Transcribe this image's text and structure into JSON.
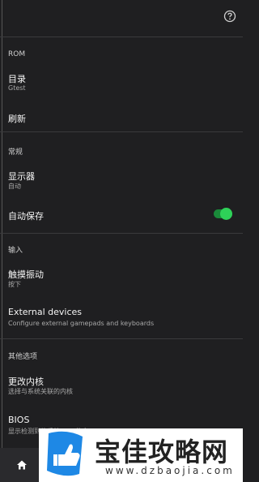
{
  "topbar": {
    "help_icon": "help-circle-icon"
  },
  "sections": {
    "rom": {
      "header": "ROM",
      "directory_title": "目录",
      "directory_sub": "Gtest",
      "refresh_title": "刷新"
    },
    "general": {
      "header": "常规",
      "display_title": "显示器",
      "display_sub": "自动",
      "autosave_title": "自动保存",
      "autosave_on": true
    },
    "input": {
      "header": "输入",
      "haptic_title": "触摸振动",
      "haptic_sub": "按下",
      "external_title": "External devices",
      "external_sub": "Configure external gamepads and keyboards"
    },
    "other": {
      "header": "其他选项",
      "core_title": "更改内核",
      "core_sub": "选择与系统关联的内核",
      "bios_title": "BIOS",
      "bios_sub": "显示检测到的系统BIOS信息"
    }
  },
  "bottom_nav": {
    "home_icon": "home-icon"
  },
  "watermark": {
    "title": "宝佳攻略网",
    "url": "www.dzbaojia.com"
  },
  "colors": {
    "accent": "#2ed158",
    "background": "#1f1f21"
  }
}
